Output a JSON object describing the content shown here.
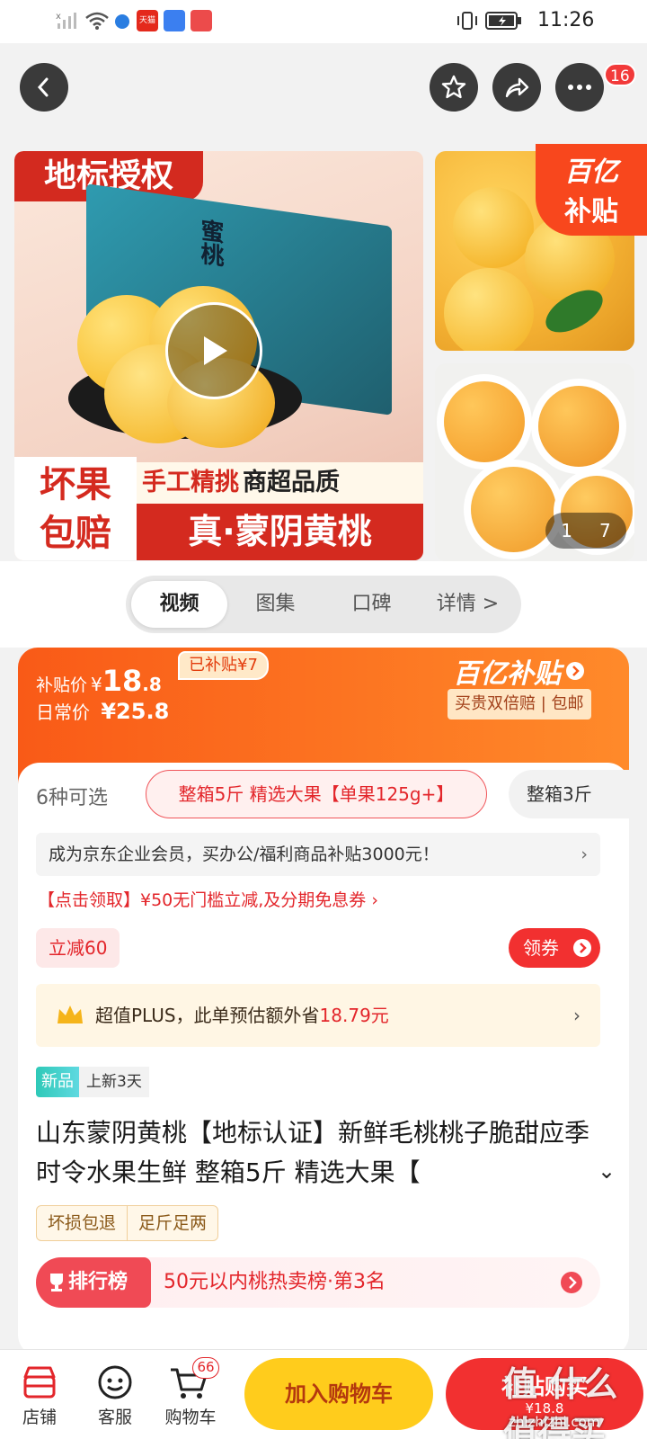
{
  "status": {
    "time": "11:26",
    "tmall_label": "天猫"
  },
  "header": {
    "badge": "16"
  },
  "gallery": {
    "main_banner_top": "地标授权",
    "box_text": "蜜桃",
    "badge_left": "坏果\n包赔",
    "ribbon1": "手工精挑",
    "ribbon2": "商超品质",
    "ribbon3": "真·蒙阴黄桃",
    "subsidy_brand": "百亿",
    "subsidy_word": "补贴",
    "counter_current": "1",
    "counter_total": "7"
  },
  "tabs": [
    "视频",
    "图集",
    "口碑",
    "详情 >"
  ],
  "price": {
    "subsidy_label": "补贴价",
    "subsidy_currency": "¥",
    "subsidy_int": "18",
    "subsidy_dec": ".8",
    "subsidized_tag": "已补贴¥7",
    "daily_label": "日常价",
    "daily_value": "¥25.8",
    "brand_right": "百亿补贴",
    "guarantee": "买贵双倍赔 | 包邮"
  },
  "options": {
    "count": "6种可选",
    "selected": "整箱5斤 精选大果【单果125g+】",
    "next": "整箱3斤"
  },
  "promo": {
    "enterprise": "成为京东企业会员，买办公/福利商品补贴3000元！",
    "coupon": "【点击领取】¥50无门槛立减,及分期免息券 ›",
    "discount_tag": "立减60",
    "coupon_button": "领券",
    "plus_prefix": "超值PLUS，此单预估额外省",
    "plus_amount": "18.79元"
  },
  "product": {
    "new_tag": "新品",
    "new_days": "上新3天",
    "title": "山东蒙阴黄桃【地标认证】新鲜毛桃桃子脆甜应季时令水果生鲜 整箱5斤 精选大果【",
    "tags": [
      "坏损包退",
      "足斤足两"
    ],
    "rank_label": "排行榜",
    "rank_text": "50元以内桃热卖榜·第3名"
  },
  "bottom": {
    "shop": "店铺",
    "service": "客服",
    "cart": "购物车",
    "cart_badge": "66",
    "add_cart": "加入购物车",
    "buy": "补贴购买",
    "buy_price": "¥18.8"
  },
  "watermark": "值 什么值得买",
  "watermark_url": "zhizhizhi.com",
  "colors": {
    "accent": "#f95a17",
    "red": "#f23030",
    "yellow": "#ffcc1c"
  }
}
